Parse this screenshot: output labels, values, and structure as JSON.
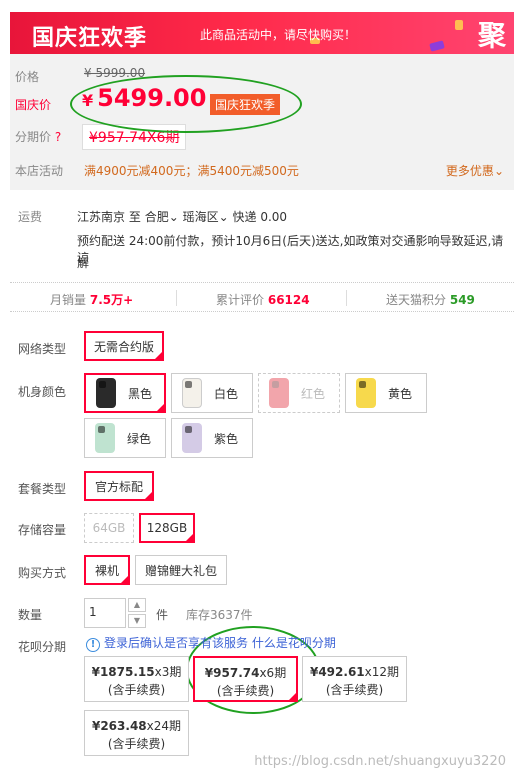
{
  "banner": {
    "title": "国庆狂欢季",
    "message": "此商品活动中，请尽快购买！",
    "badge": "聚"
  },
  "price": {
    "label": "价格",
    "original": "¥ 5999.00",
    "promo_label": "国庆价",
    "yen": "¥",
    "current": "5499.00",
    "event_tag": "国庆狂欢季"
  },
  "installment_summary": {
    "label": "分期价",
    "hint": "?",
    "value": "¥957.74X6期"
  },
  "store_promo": {
    "label": "本店活动",
    "text": "满4900元减400元；满5400元减500元",
    "more": "更多优惠"
  },
  "shipping": {
    "label": "运费",
    "from": "江苏南京",
    "to_word": "至",
    "city": "合肥",
    "district": "瑶海区",
    "method": "快递 0.00",
    "note_line1": "预约配送 24:00前付款，预计10月6日(后天)送达,如政策对交通影响导致延迟,请谅",
    "note_line2": "解"
  },
  "stats": {
    "monthly_label": "月销量",
    "monthly_value": "7.5万+",
    "reviews_label": "累计评价",
    "reviews_value": "66124",
    "points_label": "送天猫积分",
    "points_value": "549"
  },
  "options": {
    "network_label": "网络类型",
    "network_values": [
      "无需合约版"
    ],
    "color_label": "机身颜色",
    "colors": [
      {
        "name": "黑色",
        "hex": "#2a2a2a",
        "selected": true,
        "disabled": false
      },
      {
        "name": "白色",
        "hex": "#f4f1ea",
        "selected": false,
        "disabled": false
      },
      {
        "name": "红色",
        "hex": "#e0202f",
        "selected": false,
        "disabled": true
      },
      {
        "name": "黄色",
        "hex": "#f7d94c",
        "selected": false,
        "disabled": false
      },
      {
        "name": "绿色",
        "hex": "#bfe3d0",
        "selected": false,
        "disabled": false
      },
      {
        "name": "紫色",
        "hex": "#d4cbe6",
        "selected": false,
        "disabled": false
      }
    ],
    "package_label": "套餐类型",
    "package_values": [
      "官方标配"
    ],
    "storage_label": "存储容量",
    "storage_values": [
      "64GB",
      "128GB"
    ],
    "purchase_label": "购买方式",
    "purchase_values": [
      "裸机",
      "赠锦鲤大礼包"
    ]
  },
  "quantity": {
    "label": "数量",
    "value": "1",
    "unit": "件",
    "stock": "库存3637件"
  },
  "huabei": {
    "label": "花呗分期",
    "info_icon": "!",
    "info_text": "登录后确认是否享有该服务",
    "link": "什么是花呗分期",
    "plans": [
      {
        "amount": "¥1875.15",
        "periods": "x3期",
        "fee": "(含手续费)"
      },
      {
        "amount": "¥957.74",
        "periods": "x6期",
        "fee": "(含手续费)"
      },
      {
        "amount": "¥492.61",
        "periods": "x12期",
        "fee": "(含手续费)"
      },
      {
        "amount": "¥263.48",
        "periods": "x24期",
        "fee": "(含手续费)"
      }
    ]
  },
  "watermark": "https://blog.csdn.net/shuangxuyu3220",
  "colors": {
    "accent": "#ff0036",
    "ellipse": "#21a121",
    "promo": "#d2691e"
  }
}
